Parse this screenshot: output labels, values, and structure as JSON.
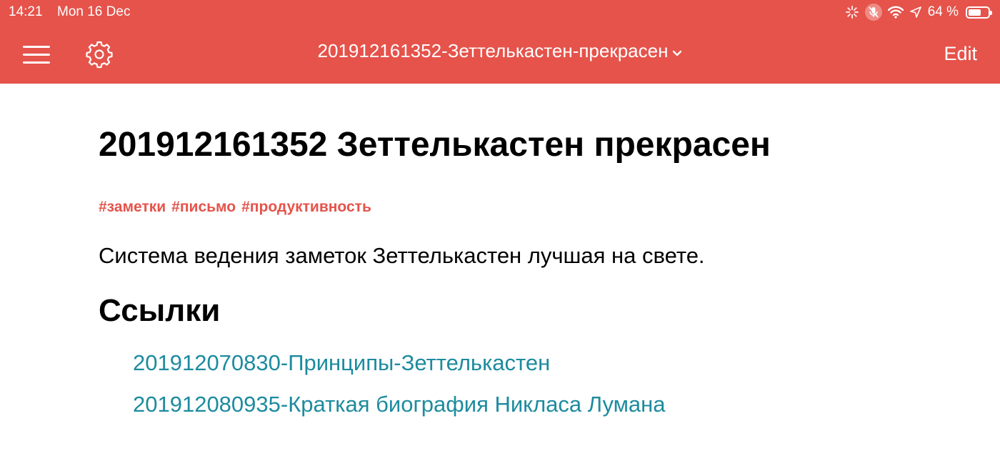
{
  "status_bar": {
    "time": "14:21",
    "date": "Mon 16 Dec",
    "battery_text": "64 %",
    "battery_level": 0.64,
    "icons": [
      "activity-spinner-icon",
      "mic-muted-icon",
      "wifi-icon",
      "location-arrow-icon",
      "battery-icon"
    ]
  },
  "nav": {
    "menu_icon": "hamburger-menu-icon",
    "settings_icon": "gear-icon",
    "title": "201912161352-Зеттелькастен-прекрасен",
    "title_icon": "chevron-down-icon",
    "edit_label": "Edit"
  },
  "document": {
    "title": "201912161352 Зеттелькастен прекрасен",
    "tags": [
      "#заметки",
      "#письмо",
      "#продуктивность"
    ],
    "paragraph": "Система ведения заметок Зеттелькастен лучшая на свете.",
    "links_heading": "Ссылки",
    "links": [
      "201912070830-Принципы-Зеттелькастен",
      "201912080935-Краткая биография Никласа Лумана"
    ]
  },
  "colors": {
    "accent": "#e5534b",
    "link": "#1d8b9f",
    "text": "#000000",
    "background": "#ffffff"
  }
}
